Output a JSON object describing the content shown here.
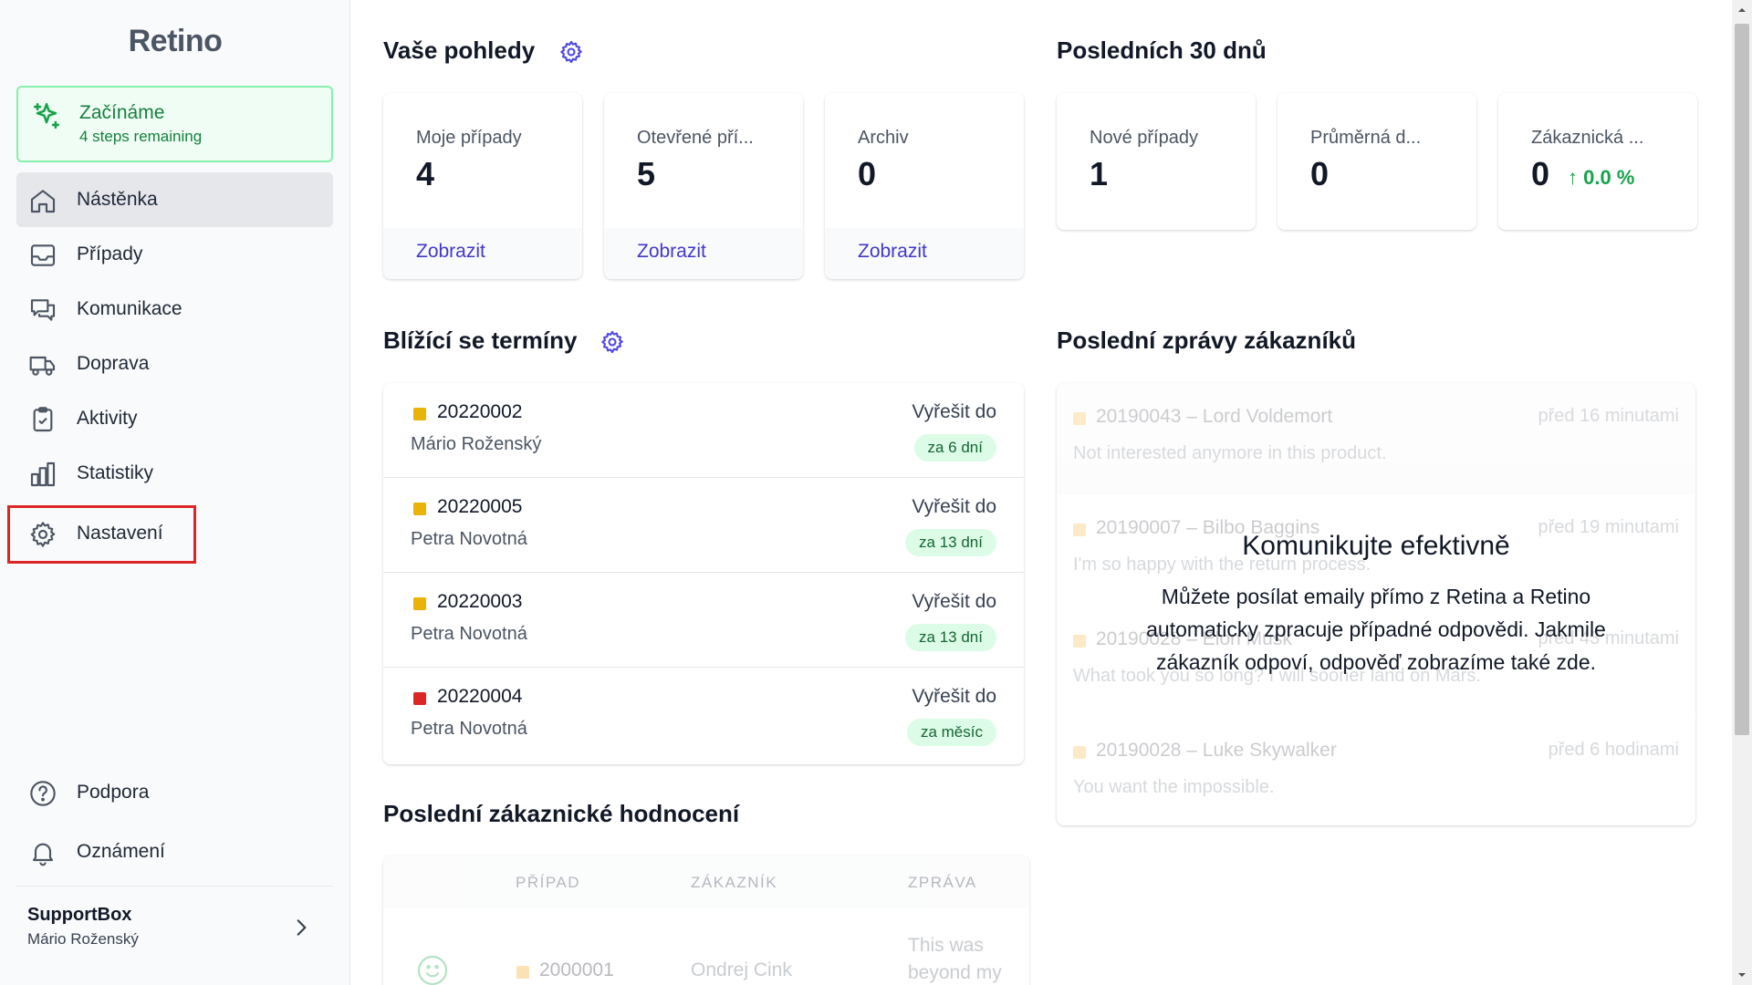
{
  "app": {
    "logo": "Retino"
  },
  "sidebar": {
    "getting_started": {
      "title": "Začínáme",
      "subtitle": "4 steps remaining"
    },
    "items": [
      {
        "label": "Nástěnka",
        "icon": "home-icon",
        "active": true
      },
      {
        "label": "Případy",
        "icon": "inbox-icon"
      },
      {
        "label": "Komunikace",
        "icon": "chat-icon"
      },
      {
        "label": "Doprava",
        "icon": "truck-icon"
      },
      {
        "label": "Aktivity",
        "icon": "clipboard-check-icon"
      },
      {
        "label": "Statistiky",
        "icon": "bar-chart-icon"
      },
      {
        "label": "Nastavení",
        "icon": "gear-icon",
        "highlighted": true
      }
    ],
    "bottom_items": [
      {
        "label": "Podpora",
        "icon": "question-circle-icon"
      },
      {
        "label": "Oznámení",
        "icon": "bell-icon"
      }
    ],
    "account": {
      "name": "SupportBox",
      "user": "Mário Roženský"
    },
    "highlight_color": "#dc2626"
  },
  "views": {
    "title": "Vaše pohledy",
    "cards": [
      {
        "label": "Moje případy",
        "value": "4",
        "link": "Zobrazit"
      },
      {
        "label": "Otevřené pří...",
        "value": "5",
        "link": "Zobrazit"
      },
      {
        "label": "Archiv",
        "value": "0",
        "link": "Zobrazit"
      }
    ]
  },
  "last30": {
    "title": "Posledních 30 dnů",
    "cards": [
      {
        "label": "Nové případy",
        "value": "1"
      },
      {
        "label": "Průměrná d...",
        "value": "0"
      },
      {
        "label": "Zákaznická ...",
        "value": "0",
        "delta": "↑ 0.0 %"
      }
    ]
  },
  "deadlines": {
    "title": "Blížící se termíny",
    "rows": [
      {
        "id": "20220002",
        "person": "Mário Roženský",
        "due_label": "Vyřešit do",
        "badge": "za 6 dní",
        "color": "#eab308"
      },
      {
        "id": "20220005",
        "person": "Petra Novotná",
        "due_label": "Vyřešit do",
        "badge": "za 13 dní",
        "color": "#eab308"
      },
      {
        "id": "20220003",
        "person": "Petra Novotná",
        "due_label": "Vyřešit do",
        "badge": "za 13 dní",
        "color": "#eab308"
      },
      {
        "id": "20220004",
        "person": "Petra Novotná",
        "due_label": "Vyřešit do",
        "badge": "za měsíc",
        "color": "#dc2626"
      }
    ]
  },
  "messages": {
    "title": "Poslední zprávy zákazníků",
    "rows": [
      {
        "head": "20190043 – Lord Voldemort",
        "time": "před 16 minutami",
        "text": "Not interested anymore in this product."
      },
      {
        "head": "20190007 – Bilbo Baggins",
        "time": "před 19 minutami",
        "text": "I'm so happy with the return process."
      },
      {
        "head": "20190028 – Elon Musk",
        "time": "před 43 minutami",
        "text": "What took you so long? I will sooner land on Mars."
      },
      {
        "head": "20190028 – Luke Skywalker",
        "time": "před 6 hodinami",
        "text": "You want the impossible."
      }
    ],
    "overlay_title": "Komunikujte efektivně",
    "overlay_text": "Můžete posílat emaily přímo z Retina a Retino automaticky zpracuje případné odpovědi. Jakmile zákazník odpoví, odpověď zobrazíme také zde."
  },
  "ratings": {
    "title": "Poslední zákaznické hodnocení",
    "columns": [
      "PŘÍPAD",
      "ZÁKAZNÍK",
      "ZPRÁVA"
    ],
    "rows": [
      {
        "case": "2000001",
        "customer": "Ondrej Cink",
        "message": "This was beyond my"
      }
    ]
  },
  "colors": {
    "accent": "#4338ca",
    "green": "#16a34a",
    "sidebar_bg": "#f9fafb"
  }
}
